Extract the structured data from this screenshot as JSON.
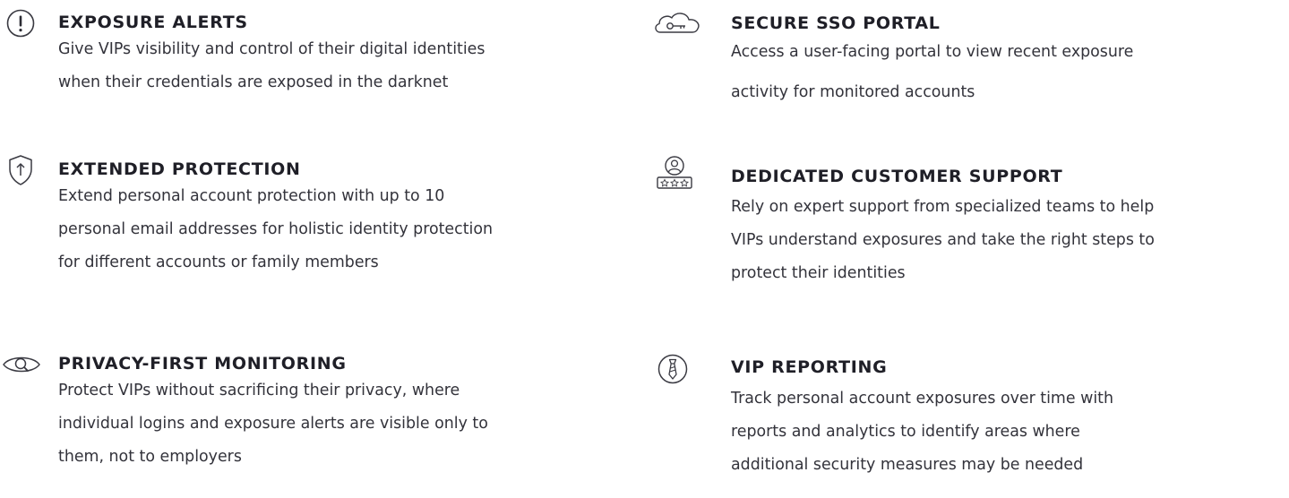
{
  "features": [
    {
      "icon": "exclamation-circle-icon",
      "title": "EXPOSURE ALERTS",
      "lines": [
        "Give VIPs visibility and control of their digital identities",
        "when their credentials are exposed in the darknet"
      ]
    },
    {
      "icon": "shield-arrow-icon",
      "title": "EXTENDED PROTECTION",
      "lines": [
        "Extend personal account protection with up to 10",
        "personal email addresses for holistic identity protection",
        "for different accounts or family members"
      ]
    },
    {
      "icon": "eye-search-icon",
      "title": "PRIVACY-FIRST MONITORING",
      "lines": [
        "Protect VIPs without sacrificing their privacy, where",
        "individual logins and exposure alerts are visible only to",
        "them, not to employers"
      ]
    },
    {
      "icon": "cloud-key-icon",
      "title": "SECURE SSO PORTAL",
      "lines": [
        "Access a user-facing portal to view recent exposure",
        "activity for monitored accounts"
      ]
    },
    {
      "icon": "support-agent-stars-icon",
      "title": "DEDICATED CUSTOMER SUPPORT",
      "lines": [
        "Rely on expert support from specialized teams to help",
        "VIPs understand exposures and take the right steps to",
        "protect their identities"
      ]
    },
    {
      "icon": "necktie-circle-icon",
      "title": "VIP REPORTING",
      "lines": [
        "Track personal account exposures over time with",
        "reports and analytics to identify areas where",
        "additional security measures may be needed"
      ]
    }
  ],
  "colors": {
    "text": "#33333b",
    "title": "#1f1f27",
    "icon_stroke": "#3a3a42",
    "background": "#ffffff"
  }
}
